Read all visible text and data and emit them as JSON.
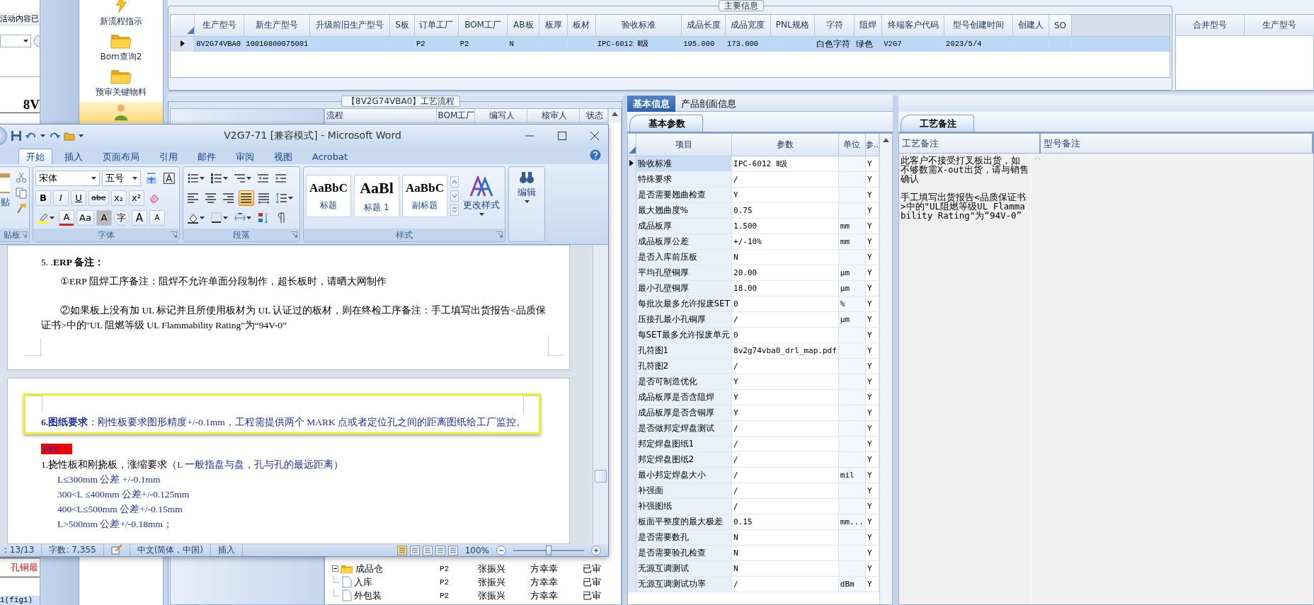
{
  "background_app": {
    "top_text": "活动内容已",
    "heading": "8V",
    "red_text": "孔铜最",
    "caption": "1(fig1)"
  },
  "nav": {
    "items": [
      {
        "kind": "bolt",
        "label": "新流程指示",
        "selected": false
      },
      {
        "kind": "folder",
        "label": "Bom查询2",
        "selected": false
      },
      {
        "kind": "folder",
        "label": "预审关键物料",
        "selected": false
      },
      {
        "kind": "person",
        "selected": true
      }
    ]
  },
  "main_info": {
    "title": "主要信息",
    "columns": [
      "生产型号",
      "新生产型号",
      "升级前旧生产型号",
      "S板",
      "订单工厂",
      "BOM工厂",
      "AB板",
      "板厚",
      "板材",
      "验收标准",
      "成品长度",
      "成品宽度",
      "PNL规格",
      "字符",
      "阻焊",
      "终端客户代码",
      "型号创建时间",
      "创建人",
      "SO"
    ],
    "rows": [
      {
        "selected": true,
        "cells": [
          "8V2G74VBA0",
          "10010800075001",
          null,
          null,
          "P2",
          "P2",
          "N",
          null,
          null,
          "IPC-6012 Ⅱ级",
          "195.000",
          "173.000",
          null,
          "白色字符",
          "绿色",
          "V2G7",
          "2023/5/4",
          null,
          null
        ]
      }
    ]
  },
  "merge_panel": {
    "columns": [
      "合并型号",
      "生产型号"
    ]
  },
  "process": {
    "title": "【8V2G74VBA0】工艺流程",
    "columns": [
      "流程",
      "BOM工厂",
      "编写人",
      "核审人",
      "状态"
    ],
    "rows": [
      {
        "expanded": true,
        "cells": [
          "成品仓",
          "P2",
          "张振兴",
          "方幸幸",
          "已审"
        ],
        "children": [
          {
            "cells": [
              "入库",
              "P2",
              "张振兴",
              "方幸幸",
              "已审"
            ]
          },
          {
            "cells": [
              "外包装",
              "P2",
              "张振兴",
              "方幸幸",
              "已审"
            ]
          }
        ]
      }
    ]
  },
  "detail": {
    "tabs": [
      {
        "label": "基本信息",
        "selected": true
      },
      {
        "label": "产品剖面信息",
        "selected": false
      }
    ],
    "subtab": "基本参数",
    "columns": [
      "项目",
      "参数",
      "单位",
      "参.."
    ],
    "rows": [
      {
        "item": "验收标准",
        "value": "IPC-6012 Ⅱ级",
        "flag": "Y",
        "selected": true
      },
      {
        "item": "特殊要求",
        "value": "/",
        "flag": "Y",
        "selected": false
      },
      {
        "item": "是否需要翘曲检查",
        "value": "Y",
        "flag": "Y",
        "selected": false
      },
      {
        "item": "最大翘曲度%",
        "value": "0.75",
        "flag": "Y",
        "selected": false
      },
      {
        "item": "成品板厚",
        "value": "1.500",
        "unit": "mm",
        "flag": "Y",
        "selected": false
      },
      {
        "item": "成品板厚公差",
        "value": "+/-10%",
        "unit": "mm",
        "flag": "Y",
        "selected": false
      },
      {
        "item": "是否入库前压板",
        "value": "N",
        "flag": "Y",
        "selected": false
      },
      {
        "item": "平均孔壁铜厚",
        "value": "20.00",
        "unit": "μm",
        "flag": "Y",
        "selected": false
      },
      {
        "item": "最小孔壁铜厚",
        "value": "18.00",
        "unit": "μm",
        "flag": "Y",
        "selected": false
      },
      {
        "item": "每批次最多允许报废SET",
        "value": "0",
        "unit": "%",
        "flag": "Y",
        "selected": false
      },
      {
        "item": "压接孔最小孔铜厚",
        "value": "/",
        "unit": "μm",
        "flag": "Y",
        "selected": false
      },
      {
        "item": "每SET最多允许报废单元",
        "value": "0",
        "flag": "Y",
        "selected": false
      },
      {
        "item": "孔符图1",
        "value": "8v2g74vba0_drl_map.pdf",
        "flag": "Y",
        "selected": false
      },
      {
        "item": "孔符图2",
        "value": "/",
        "flag": "Y",
        "selected": false
      },
      {
        "item": "是否可制造优化",
        "value": "Y",
        "flag": "Y",
        "selected": false
      },
      {
        "item": "成品板厚是否含阻焊",
        "value": "Y",
        "flag": "Y",
        "selected": false
      },
      {
        "item": "成品板厚是否含铜厚",
        "value": "Y",
        "flag": "Y",
        "selected": false
      },
      {
        "item": "是否做邦定焊盘测试",
        "value": "/",
        "flag": "Y",
        "selected": false
      },
      {
        "item": "邦定焊盘图纸1",
        "value": "/",
        "flag": "Y",
        "selected": false
      },
      {
        "item": "邦定焊盘图纸2",
        "value": "/",
        "flag": "Y",
        "selected": false
      },
      {
        "item": "最小邦定焊盘大小",
        "value": "/",
        "unit": "mil",
        "flag": "Y",
        "selected": false
      },
      {
        "item": "补强面",
        "value": "/",
        "flag": "Y",
        "selected": false
      },
      {
        "item": "补强图纸",
        "value": "/",
        "flag": "Y",
        "selected": false
      },
      {
        "item": "板面平整度的最大极差",
        "value": "0.15",
        "unit": "mm...",
        "flag": "Y",
        "selected": false
      },
      {
        "item": "是否需要数孔",
        "value": "N",
        "flag": "Y",
        "selected": false
      },
      {
        "item": "是否需要验孔检查",
        "value": "N",
        "flag": "Y",
        "selected": false
      },
      {
        "item": "无源互调测试",
        "value": "N",
        "flag": "Y",
        "selected": false
      },
      {
        "item": "无源互调测试功率",
        "value": "/",
        "unit": "dBm",
        "flag": "Y",
        "selected": false
      }
    ]
  },
  "notes": {
    "subtab": "工艺备注",
    "columns": [
      "工艺备注",
      "型号备注"
    ],
    "process_notes": [
      "此客户不接受打叉板出货，如不够数需X-out出货，请与销售确认",
      "手工填写出货报告<品质保证书>中的\"UL阻燃等级UL Flammability Rating\"为“94V-0”"
    ]
  },
  "word": {
    "title": "V2G7-71 [兼容模式] - Microsoft Word",
    "tabs": [
      {
        "label": "开始",
        "selected": true
      },
      {
        "label": "插入",
        "selected": false
      },
      {
        "label": "页面布局",
        "selected": false
      },
      {
        "label": "引用",
        "selected": false
      },
      {
        "label": "邮件",
        "selected": false
      },
      {
        "label": "审阅",
        "selected": false
      },
      {
        "label": "视图",
        "selected": false
      },
      {
        "label": "Acrobat",
        "selected": false
      }
    ],
    "ribbon": {
      "clipboard": {
        "paste": "贴",
        "label": "贴板"
      },
      "font": {
        "face": "宋体",
        "size": "五号",
        "format_buttons": [
          "B",
          "I",
          "U",
          "abe",
          "x₂",
          "x²"
        ],
        "effect_buttons": [
          "A",
          "Aa",
          "A",
          "字",
          "A",
          "A"
        ],
        "label": "字体"
      },
      "paragraph": {
        "label": "段落",
        "alignments": [
          {
            "selected": false
          },
          {
            "selected": false
          },
          {
            "selected": false
          },
          {
            "selected": true
          },
          {
            "selected": false
          }
        ]
      },
      "styles": {
        "items": [
          {
            "preview": "AaBbC",
            "name": "标题"
          },
          {
            "preview": "AaBl",
            "name": "标题 1"
          },
          {
            "preview": "AaBbC",
            "name": "副标题"
          }
        ],
        "change": "更改样式",
        "label": "样式"
      },
      "editing": {
        "label": "编辑"
      }
    },
    "pages": [
      {
        "blocks": [
          {
            "kind": "heading",
            "text": "5. .**ERP 备注：**"
          },
          {
            "kind": "indented",
            "text": "①ERP 阻焊工序备注：阻焊不允许单面分段制作，超长板时，请晒大网制作"
          },
          {
            "kind": "blank"
          },
          {
            "kind": "indented",
            "text": "②如果板上没有加 UL 标记并且所使用板材为 UL 认证过的板材，则在终检工序备注：手工填写出货报告<品质保证书>中的\"UL 阻燃等级 UL Flammability Rating\"为“94V-0”"
          },
          {
            "kind": "corners"
          }
        ]
      },
      {
        "blocks": [
          {
            "kind": "boxed",
            "text": "**6.图纸要求**：刚性板要求图形精度+/-0.1mm，工程需提供两个 MARK 点或者定位孔之间的距离图纸给工厂监控。"
          },
          {
            "kind": "flag",
            "text": "FPC："
          },
          {
            "kind": "mixed",
            "text": "1.挠性板和刚挠板，涨缩要求",
            "note": "（L 一般指盘与盘，孔与孔的最远距离）"
          },
          {
            "kind": "sub",
            "text": "L≤300mm 公差 +/-0.1mm"
          },
          {
            "kind": "sub",
            "text": "300<L ≤400mm 公差+/-0.125mm"
          },
          {
            "kind": "sub",
            "text": "400<L≤500mm 公差+/-0.15mm"
          },
          {
            "kind": "sub",
            "text": "L>500mm 公差+/-0.18mm；"
          }
        ]
      }
    ],
    "status": {
      "page": ": 13/13",
      "words": "字数: 7,355",
      "language": "中文(简体，中国)",
      "mode": "插入",
      "zoom": "100%",
      "level": 0.5
    }
  }
}
